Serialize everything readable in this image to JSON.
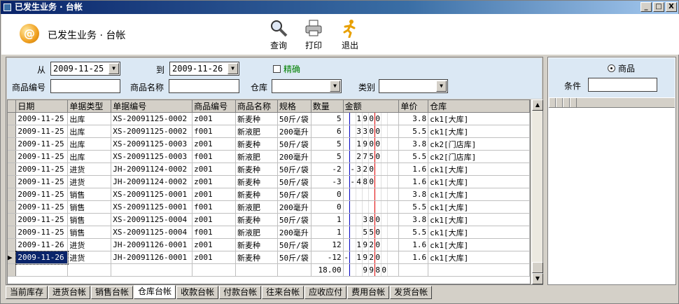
{
  "window": {
    "title": "已发生业务 · 台帐",
    "btn_min": "_",
    "btn_max": "□",
    "btn_close": "X"
  },
  "header": {
    "logo_glyph": "@",
    "title": "已发生业务 · 台帐"
  },
  "toolbar": {
    "query": "查询",
    "print": "打印",
    "exit": "退出"
  },
  "filter": {
    "from_label": "从",
    "from_value": "2009-11-25",
    "to_label": "到",
    "to_value": "2009-11-26",
    "exact_label": "精确",
    "product_code_label": "商品编号",
    "product_name_label": "商品名称",
    "warehouse_label": "仓库",
    "category_label": "类别"
  },
  "table": {
    "headers": [
      "日期",
      "单据类型",
      "单据编号",
      "商品编号",
      "商品名称",
      "规格",
      "数量",
      "金额",
      "单价",
      "仓库"
    ],
    "rows": [
      [
        "2009-11-25",
        "出库",
        "XS-20091125-0002",
        "z001",
        "新麦种",
        "50斤/袋",
        "5",
        [
          "",
          "",
          "1",
          "9",
          "0",
          "0",
          ""
        ],
        "3.8",
        "ck1[大库]"
      ],
      [
        "2009-11-25",
        "出库",
        "XS-20091125-0002",
        "f001",
        "新液肥",
        "200毫升",
        "6",
        [
          "",
          "",
          "3",
          "3",
          "0",
          "0",
          ""
        ],
        "5.5",
        "ck1[大库]"
      ],
      [
        "2009-11-25",
        "出库",
        "XS-20091125-0003",
        "z001",
        "新麦种",
        "50斤/袋",
        "5",
        [
          "",
          "",
          "1",
          "9",
          "0",
          "0",
          ""
        ],
        "3.8",
        "ck2[门店库]"
      ],
      [
        "2009-11-25",
        "出库",
        "XS-20091125-0003",
        "f001",
        "新液肥",
        "200毫升",
        "5",
        [
          "",
          "",
          "2",
          "7",
          "5",
          "0",
          ""
        ],
        "5.5",
        "ck2[门店库]"
      ],
      [
        "2009-11-25",
        "进货",
        "JH-20091124-0002",
        "z001",
        "新麦种",
        "50斤/袋",
        "-2",
        [
          "",
          "-",
          "3",
          "2",
          "0",
          "",
          ""
        ],
        "1.6",
        "ck1[大库]"
      ],
      [
        "2009-11-25",
        "进货",
        "JH-20091124-0002",
        "z001",
        "新麦种",
        "50斤/袋",
        "-3",
        [
          "",
          "-",
          "4",
          "8",
          "0",
          "",
          ""
        ],
        "1.6",
        "ck1[大库]"
      ],
      [
        "2009-11-25",
        "销售",
        "XS-20091125-0001",
        "z001",
        "新麦种",
        "50斤/袋",
        "0",
        [
          "",
          "",
          "",
          "",
          "",
          "",
          ""
        ],
        "3.8",
        "ck1[大库]"
      ],
      [
        "2009-11-25",
        "销售",
        "XS-20091125-0001",
        "f001",
        "新液肥",
        "200毫升",
        "0",
        [
          "",
          "",
          "",
          "",
          "",
          "",
          ""
        ],
        "5.5",
        "ck1[大库]"
      ],
      [
        "2009-11-25",
        "销售",
        "XS-20091125-0004",
        "z001",
        "新麦种",
        "50斤/袋",
        "1",
        [
          "",
          "",
          "",
          "3",
          "8",
          "0",
          ""
        ],
        "3.8",
        "ck1[大库]"
      ],
      [
        "2009-11-25",
        "销售",
        "XS-20091125-0004",
        "f001",
        "新液肥",
        "200毫升",
        "1",
        [
          "",
          "",
          "",
          "5",
          "5",
          "0",
          ""
        ],
        "5.5",
        "ck1[大库]"
      ],
      [
        "2009-11-26",
        "进货",
        "JH-20091126-0001",
        "z001",
        "新麦种",
        "50斤/袋",
        "12",
        [
          "",
          "",
          "1",
          "9",
          "2",
          "0",
          ""
        ],
        "1.6",
        "ck1[大库]"
      ],
      [
        "2009-11-26",
        "进货",
        "JH-20091126-0001",
        "z001",
        "新麦种",
        "50斤/袋",
        "-12",
        [
          "-",
          "",
          "1",
          "9",
          "2",
          "0",
          ""
        ],
        "1.6",
        "ck1[大库]"
      ]
    ],
    "selected_row": 11,
    "total_qty": "18.00",
    "total_amount": [
      "",
      "",
      "",
      "9",
      "9",
      "8",
      "0"
    ]
  },
  "tabs": [
    "当前库存",
    "进货台帐",
    "销售台帐",
    "仓库台帐",
    "收款台帐",
    "付款台帐",
    "往来台帐",
    "应收应付",
    "费用台帐",
    "发货台帐"
  ],
  "active_tab": 3,
  "right": {
    "radio_label": "商品",
    "condition_label": "条件"
  },
  "colors": {
    "title_start": "#0a246a",
    "filter_bg": "#dbe8f4",
    "amount_blue": "#0000c0",
    "amount_red": "#e00000"
  }
}
